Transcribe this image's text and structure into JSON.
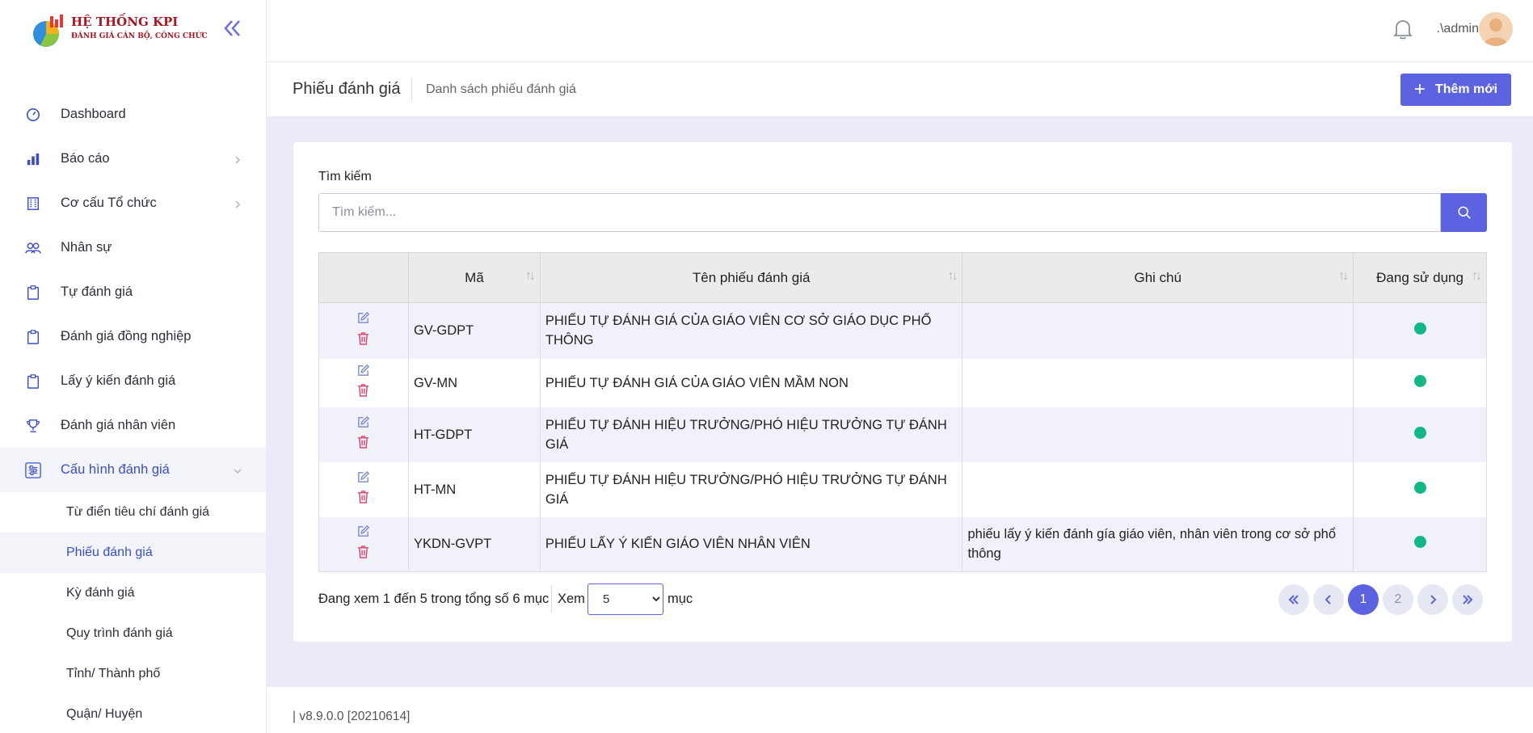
{
  "brand": {
    "title": "HỆ THỐNG KPI",
    "subtitle": "ĐÁNH GIÁ CÁN BỘ, CÔNG CHỨC"
  },
  "sidebar": {
    "items": [
      {
        "label": "Dashboard",
        "icon": "dashboard-icon"
      },
      {
        "label": "Báo cáo",
        "icon": "bar-chart-icon"
      },
      {
        "label": "Cơ cấu Tổ chức",
        "icon": "building-icon"
      },
      {
        "label": "Nhân sự",
        "icon": "users-icon"
      },
      {
        "label": "Tự đánh giá",
        "icon": "clipboard-icon"
      },
      {
        "label": "Đánh giá đồng nghiệp",
        "icon": "clipboard-icon"
      },
      {
        "label": "Lấy ý kiến đánh giá",
        "icon": "clipboard-icon"
      },
      {
        "label": "Đánh giá nhân viên",
        "icon": "trophy-icon"
      },
      {
        "label": "Cấu hình đánh giá",
        "icon": "settings-sliders-icon"
      }
    ],
    "subitems": [
      "Từ điển tiêu chí đánh giá",
      "Phiếu đánh giá",
      "Kỳ đánh giá",
      "Quy trình đánh giá",
      "Tỉnh/ Thành phố",
      "Quận/ Huyện"
    ]
  },
  "topbar": {
    "username": ".\\admin"
  },
  "header": {
    "title": "Phiếu đánh giá",
    "subtitle": "Danh sách phiếu đánh giá",
    "add_label": "Thêm mới"
  },
  "search": {
    "label": "Tìm kiếm",
    "placeholder": "Tìm kiếm..."
  },
  "table": {
    "columns": [
      "Mã",
      "Tên phiếu đánh giá",
      "Ghi chú",
      "Đang sử dụng"
    ],
    "rows": [
      {
        "code": "GV-GDPT",
        "name": "PHIẾU TỰ ĐÁNH GIÁ CỦA GIÁO VIÊN CƠ SỞ GIÁO DỤC PHỔ THÔNG",
        "note": "",
        "active": true
      },
      {
        "code": "GV-MN",
        "name": "PHIẾU TỰ ĐÁNH GIÁ CỦA GIÁO VIÊN MẦM NON",
        "note": "",
        "active": true
      },
      {
        "code": "HT-GDPT",
        "name": "PHIẾU TỰ ĐÁNH HIỆU TRƯỞNG/PHÓ HIỆU TRƯỞNG TỰ ĐÁNH GIÁ",
        "note": "",
        "active": true
      },
      {
        "code": "HT-MN",
        "name": "PHIẾU TỰ ĐÁNH HIỆU TRƯỞNG/PHÓ HIỆU TRƯỞNG TỰ ĐÁNH GIÁ",
        "note": "",
        "active": true
      },
      {
        "code": "YKDN-GVPT",
        "name": "PHIẾU LẤY Ý KIẾN GIÁO VIÊN NHÂN VIÊN",
        "note": "phiếu lấy ý kiến đánh gía giáo viên, nhân viên trong cơ sở phổ thông",
        "active": true
      }
    ]
  },
  "pagination": {
    "info": "Đang xem 1 đến 5 trong tổng số 6 mục",
    "show_label": "Xem",
    "page_size": "5",
    "unit_label": "mục",
    "pages": [
      "1",
      "2"
    ],
    "current": "1"
  },
  "footer": {
    "version": "| v8.9.0.0 [20210614]"
  },
  "colors": {
    "accent": "#5b63e0",
    "active_dot": "#12b886",
    "delete": "#e0446b",
    "brand_red": "#b0141e"
  }
}
